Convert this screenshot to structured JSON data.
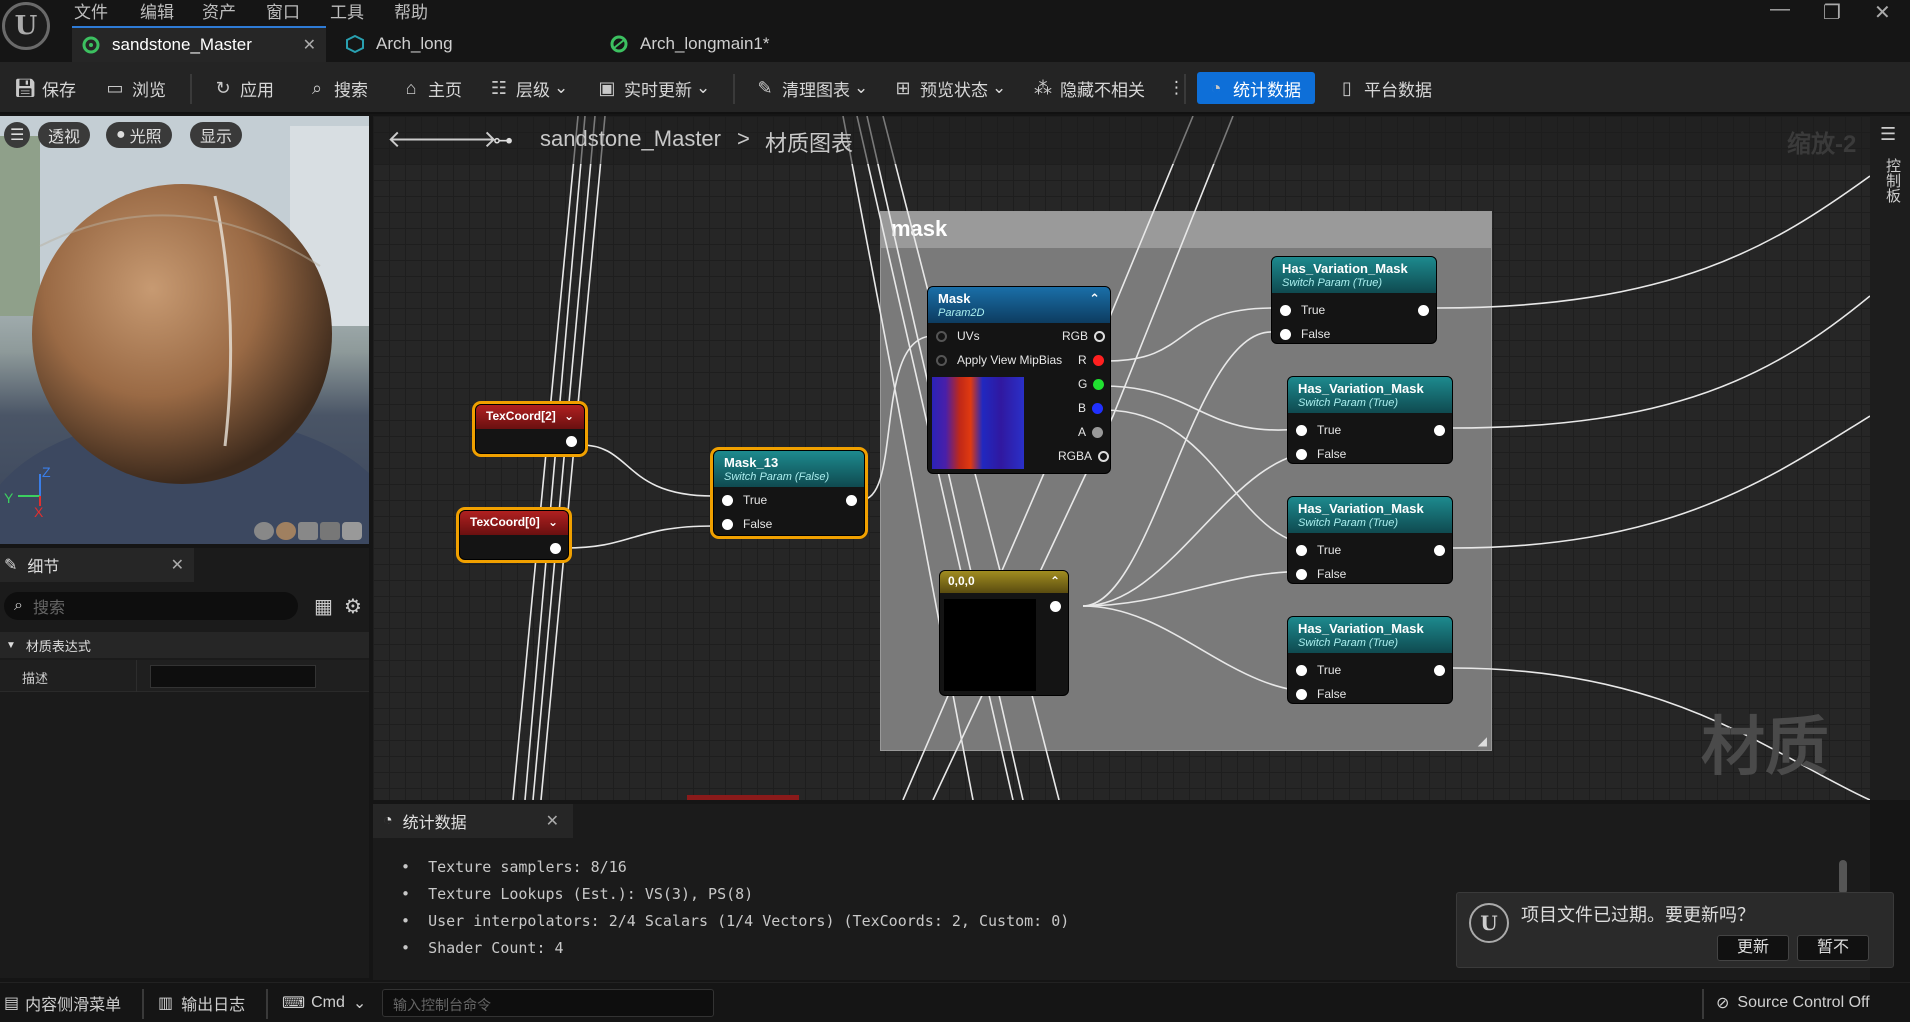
{
  "menu": {
    "file": "文件",
    "edit": "编辑",
    "asset": "资产",
    "window": "窗口",
    "tools": "工具",
    "help": "帮助"
  },
  "tabs": [
    {
      "label": "sandstone_Master",
      "icon": "material-icon",
      "color": "#3cc060"
    },
    {
      "label": "Arch_long",
      "icon": "static-mesh-icon",
      "color": "#29a0b0"
    },
    {
      "label": "Arch_longmain1*",
      "icon": "material-instance-icon",
      "color": "#3cc060"
    }
  ],
  "toolbar": {
    "save": "保存",
    "browse": "浏览",
    "apply": "应用",
    "search": "搜索",
    "home": "主页",
    "hierarchy": "层级",
    "live_update": "实时更新",
    "clean_graph": "清理图表",
    "preview_state": "预览状态",
    "hide_unrelated": "隐藏不相关",
    "stats": "统计数据",
    "platform_stats": "平台数据"
  },
  "viewport": {
    "perspective": "透视",
    "lit": "光照",
    "show": "显示",
    "axis_z": "Z",
    "axis_y": "Y",
    "axis_x": "X"
  },
  "details": {
    "title": "细节",
    "search_placeholder": "搜索",
    "section": "材质表达式",
    "row_label": "描述"
  },
  "graph": {
    "breadcrumb_root": "sandstone_Master",
    "breadcrumb_sep": ">",
    "breadcrumb_leaf": "材质图表",
    "zoom": "缩放-2",
    "side_label": "控制板",
    "watermark": "材质",
    "comment_title": "mask",
    "nodes": {
      "texcoord2": "TexCoord[2]",
      "texcoord0": "TexCoord[0]",
      "mask13": {
        "title": "Mask_13",
        "sub": "Switch Param (False)",
        "true": "True",
        "false": "False"
      },
      "mask": {
        "title": "Mask",
        "sub": "Param2D",
        "uvs": "UVs",
        "mip": "Apply View MipBias",
        "rgb": "RGB",
        "r": "R",
        "g": "G",
        "b": "B",
        "a": "A",
        "rgba": "RGBA"
      },
      "const": "0,0,0",
      "variation": {
        "title": "Has_Variation_Mask",
        "sub": "Switch Param (True)",
        "true": "True",
        "false": "False"
      }
    }
  },
  "stats": {
    "tab": "统计数据",
    "lines": [
      "Texture samplers: 8/16",
      "Texture Lookups (Est.): VS(3), PS(8)",
      "User interpolators: 2/4 Scalars (1/4 Vectors) (TexCoords: 2, Custom: 0)",
      "Shader Count: 4"
    ]
  },
  "toast": {
    "message": "项目文件已过期。要更新吗？",
    "update": "更新",
    "later": "暂不"
  },
  "statusbar": {
    "content_drawer": "内容侧滑菜单",
    "output_log": "输出日志",
    "cmd": "Cmd",
    "console_placeholder": "输入控制台命令",
    "source_control": "Source Control Off"
  }
}
